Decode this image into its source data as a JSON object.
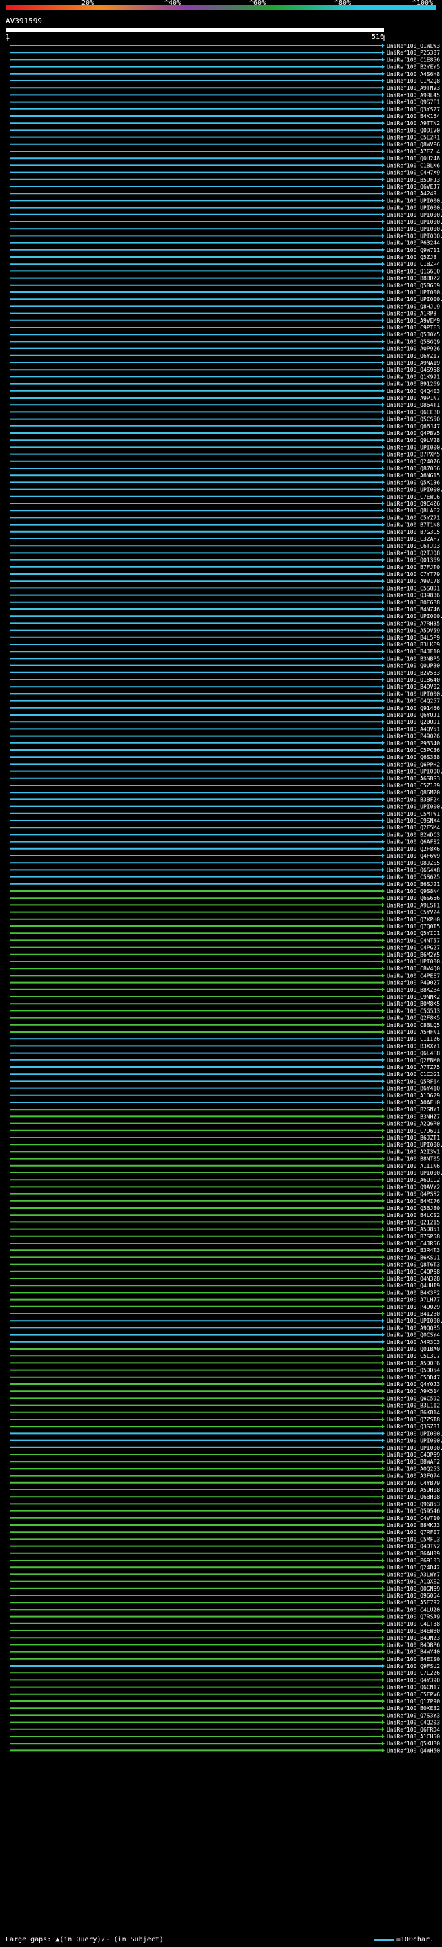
{
  "header": {
    "ticks": [
      "20%",
      "^40%",
      "^60%",
      "^80%",
      "^100%"
    ],
    "query_name": "AV391599",
    "start_label": "1",
    "end_label": "516"
  },
  "colors": {
    "background": "#000000",
    "gradient": [
      "#e8171f",
      "#f28a1c",
      "#8a3ea8",
      "#1fa52f",
      "#27c5e8"
    ],
    "cyan": "#3fc1e8",
    "green": "#4cc23a",
    "magenta": "#c12b9a",
    "white": "#ffffff"
  },
  "footer": {
    "large_gaps_label": "Large gaps: ▲(in Query)/~ (in Subject)",
    "scale_label": "=100char."
  },
  "chart_data": {
    "type": "alignment",
    "query_length": 516,
    "hits": [
      {
        "id": "UniRef100_Q1WLW3",
        "c": "cyan"
      },
      {
        "id": "UniRef100_P25387",
        "c": "cyan"
      },
      {
        "id": "UniRef100_C1E856",
        "c": "cyan"
      },
      {
        "id": "UniRef100_B2YEY5",
        "c": "cyan"
      },
      {
        "id": "UniRef100_A4S6H8",
        "c": "cyan"
      },
      {
        "id": "UniRef100_C1MZQ8",
        "c": "cyan"
      },
      {
        "id": "UniRef100_A9TNV3",
        "c": "cyan"
      },
      {
        "id": "UniRef100_A9RL45",
        "c": "cyan"
      },
      {
        "id": "UniRef100_Q9S7F1",
        "c": "cyan"
      },
      {
        "id": "UniRef100_Q3YS27",
        "c": "cyan"
      },
      {
        "id": "UniRef100_B4K164",
        "c": "cyan"
      },
      {
        "id": "UniRef100_A9TTN2",
        "c": "cyan"
      },
      {
        "id": "UniRef100_Q0DIV0",
        "c": "cyan"
      },
      {
        "id": "UniRef100_C5E2R1",
        "c": "cyan"
      },
      {
        "id": "UniRef100_Q8WVP6",
        "c": "cyan"
      },
      {
        "id": "UniRef100_A7EZL4",
        "c": "cyan"
      },
      {
        "id": "UniRef100_Q0U248",
        "c": "cyan"
      },
      {
        "id": "UniRef100_C1BLK6",
        "c": "cyan"
      },
      {
        "id": "UniRef100_C4H7X9",
        "c": "cyan"
      },
      {
        "id": "UniRef100_B5DFJ3",
        "c": "cyan"
      },
      {
        "id": "UniRef100_Q6VEJ7",
        "c": "cyan"
      },
      {
        "id": "UniRef100_A4249",
        "c": "cyan"
      },
      {
        "id": "UniRef100_UPI000...",
        "c": "cyan"
      },
      {
        "id": "UniRef100_UPI000...",
        "c": "cyan"
      },
      {
        "id": "UniRef100_UPI000...",
        "c": "cyan"
      },
      {
        "id": "UniRef100_UPI000...",
        "c": "cyan"
      },
      {
        "id": "UniRef100_UPI000...",
        "c": "cyan"
      },
      {
        "id": "UniRef100_UPI000...",
        "c": "cyan"
      },
      {
        "id": "UniRef100_P63244",
        "c": "cyan"
      },
      {
        "id": "UniRef100_Q9W711",
        "c": "cyan"
      },
      {
        "id": "UniRef100_Q5ZJ8",
        "c": "cyan"
      },
      {
        "id": "UniRef100_C1BZP4",
        "c": "cyan"
      },
      {
        "id": "UniRef100_Q1G6E0",
        "c": "cyan"
      },
      {
        "id": "UniRef100_B8BDZ2",
        "c": "cyan"
      },
      {
        "id": "UniRef100_Q5BG69",
        "c": "cyan"
      },
      {
        "id": "UniRef100_UPI000...",
        "c": "cyan"
      },
      {
        "id": "UniRef100_UPI000...",
        "c": "cyan"
      },
      {
        "id": "UniRef100_Q8HJL9",
        "c": "cyan"
      },
      {
        "id": "UniRef100_A1RP8",
        "c": "cyan"
      },
      {
        "id": "UniRef100_A9VEM9",
        "c": "cyan"
      },
      {
        "id": "UniRef100_C9PTF3",
        "c": "cyan"
      },
      {
        "id": "UniRef100_Q5J0Y5",
        "c": "cyan"
      },
      {
        "id": "UniRef100_Q5SGQ9",
        "c": "cyan"
      },
      {
        "id": "UniRef100_A0P926",
        "c": "cyan"
      },
      {
        "id": "UniRef100_Q6YZ17",
        "c": "cyan"
      },
      {
        "id": "UniRef100_A9NA19",
        "c": "cyan"
      },
      {
        "id": "UniRef100_Q4S958",
        "c": "cyan"
      },
      {
        "id": "UniRef100_Q1K991",
        "c": "cyan"
      },
      {
        "id": "UniRef100_B91269",
        "c": "cyan"
      },
      {
        "id": "UniRef100_Q4Q403",
        "c": "cyan"
      },
      {
        "id": "UniRef100_A9P1N7",
        "c": "cyan"
      },
      {
        "id": "UniRef100_Q864T1",
        "c": "cyan"
      },
      {
        "id": "UniRef100_Q6EEB0",
        "c": "cyan"
      },
      {
        "id": "UniRef100_Q5CS50",
        "c": "cyan"
      },
      {
        "id": "UniRef100_Q66J47",
        "c": "cyan"
      },
      {
        "id": "UniRef100_Q4PBV5",
        "c": "cyan"
      },
      {
        "id": "UniRef100_Q9LV28",
        "c": "cyan"
      },
      {
        "id": "UniRef100_UPI000...",
        "c": "cyan"
      },
      {
        "id": "UniRef100_B7PXM5",
        "c": "cyan"
      },
      {
        "id": "UniRef100_Q24076",
        "c": "cyan"
      },
      {
        "id": "UniRef100_Q87066",
        "c": "cyan"
      },
      {
        "id": "UniRef100_A6NG15",
        "c": "cyan"
      },
      {
        "id": "UniRef100_Q5X136",
        "c": "cyan"
      },
      {
        "id": "UniRef100_UPI000...",
        "c": "cyan"
      },
      {
        "id": "UniRef100_C7EWL6",
        "c": "cyan"
      },
      {
        "id": "UniRef100_Q9C4Z6",
        "c": "cyan"
      },
      {
        "id": "UniRef100_Q8LAF2",
        "c": "cyan"
      },
      {
        "id": "UniRef100_C5YZ71",
        "c": "cyan"
      },
      {
        "id": "UniRef100_B7T1N8",
        "c": "cyan"
      },
      {
        "id": "UniRef100_B7G3C5",
        "c": "cyan"
      },
      {
        "id": "UniRef100_C3ZAF7",
        "c": "cyan"
      },
      {
        "id": "UniRef100_C6TJD3",
        "c": "cyan"
      },
      {
        "id": "UniRef100_Q2TJQ8",
        "c": "cyan"
      },
      {
        "id": "UniRef100_Q01369",
        "c": "cyan"
      },
      {
        "id": "UniRef100_B7FJT0",
        "c": "cyan"
      },
      {
        "id": "UniRef100_C7YT79",
        "c": "cyan"
      },
      {
        "id": "UniRef100_A9V178",
        "c": "cyan"
      },
      {
        "id": "UniRef100_C5SQD1",
        "c": "cyan"
      },
      {
        "id": "UniRef100_Q39836",
        "c": "cyan"
      },
      {
        "id": "UniRef100_B0EGB8",
        "c": "cyan"
      },
      {
        "id": "UniRef100_B4NZ46",
        "c": "cyan"
      },
      {
        "id": "UniRef100_UPI000...",
        "c": "cyan"
      },
      {
        "id": "UniRef100_A7RH35",
        "c": "cyan"
      },
      {
        "id": "UniRef100_A5DV59",
        "c": "cyan"
      },
      {
        "id": "UniRef100_B4L5P9",
        "c": "cyan"
      },
      {
        "id": "UniRef100_B3LKF9",
        "c": "cyan"
      },
      {
        "id": "UniRef100_B4JE10",
        "c": "cyan"
      },
      {
        "id": "UniRef100_B3NBP5",
        "c": "cyan"
      },
      {
        "id": "UniRef100_Q0UP30",
        "c": "cyan"
      },
      {
        "id": "UniRef100_B2V583",
        "c": "cyan"
      },
      {
        "id": "UniRef100_Q18640",
        "c": "cyan"
      },
      {
        "id": "UniRef100_B4DV02",
        "c": "cyan"
      },
      {
        "id": "UniRef100_UPI000...",
        "c": "cyan"
      },
      {
        "id": "UniRef100_C4Q257",
        "c": "cyan"
      },
      {
        "id": "UniRef100_Q91456",
        "c": "cyan"
      },
      {
        "id": "UniRef100_Q6YUJ1",
        "c": "cyan"
      },
      {
        "id": "UniRef100_Q20UD1",
        "c": "cyan"
      },
      {
        "id": "UniRef100_A4QV51",
        "c": "cyan"
      },
      {
        "id": "UniRef100_P49026",
        "c": "cyan"
      },
      {
        "id": "UniRef100_P93340",
        "c": "cyan"
      },
      {
        "id": "UniRef100_C5PC36",
        "c": "cyan"
      },
      {
        "id": "UniRef100_Q6S338",
        "c": "cyan"
      },
      {
        "id": "UniRef100_Q6PPH2",
        "c": "cyan"
      },
      {
        "id": "UniRef100_UPI000...",
        "c": "cyan"
      },
      {
        "id": "UniRef100_A6SBS3",
        "c": "cyan"
      },
      {
        "id": "UniRef100_C5Z189",
        "c": "cyan"
      },
      {
        "id": "UniRef100_Q86M20",
        "c": "cyan"
      },
      {
        "id": "UniRef100_B3BF24",
        "c": "cyan"
      },
      {
        "id": "UniRef100_UPI000...",
        "c": "cyan"
      },
      {
        "id": "UniRef100_C5MTW1",
        "c": "cyan"
      },
      {
        "id": "UniRef100_C9SNX4",
        "c": "cyan"
      },
      {
        "id": "UniRef100_Q2F5M4",
        "c": "cyan"
      },
      {
        "id": "UniRef100_B2WDC3",
        "c": "cyan"
      },
      {
        "id": "UniRef100_Q6AFS2",
        "c": "cyan"
      },
      {
        "id": "UniRef100_Q2F8K6",
        "c": "cyan"
      },
      {
        "id": "UniRef100_Q4F6W9",
        "c": "cyan"
      },
      {
        "id": "UniRef100_Q8JZS5",
        "c": "cyan"
      },
      {
        "id": "UniRef100_Q6S4X8",
        "c": "cyan"
      },
      {
        "id": "UniRef100_C5S625",
        "c": "cyan"
      },
      {
        "id": "UniRef100_B6SJ21",
        "c": "cyan"
      },
      {
        "id": "UniRef100_Q9S8N4",
        "c": "green"
      },
      {
        "id": "UniRef100_Q6S656",
        "c": "green"
      },
      {
        "id": "UniRef100_A9LST1",
        "c": "green"
      },
      {
        "id": "UniRef100_C5YV24",
        "c": "green"
      },
      {
        "id": "UniRef100_Q7XPH0",
        "c": "green"
      },
      {
        "id": "UniRef100_Q7Q0T5",
        "c": "green"
      },
      {
        "id": "UniRef100_Q5YIC1",
        "c": "green"
      },
      {
        "id": "UniRef100_C4NT57",
        "c": "green"
      },
      {
        "id": "UniRef100_C4PG27",
        "c": "green"
      },
      {
        "id": "UniRef100_B6M2Y5",
        "c": "green"
      },
      {
        "id": "UniRef100_UPI000...",
        "c": "green"
      },
      {
        "id": "UniRef100_C8V4Q0",
        "c": "green"
      },
      {
        "id": "UniRef100_C4PEE7",
        "c": "green"
      },
      {
        "id": "UniRef100_P49027",
        "c": "green"
      },
      {
        "id": "UniRef100_B8KZB4",
        "c": "green"
      },
      {
        "id": "UniRef100_C9NNK2",
        "c": "green"
      },
      {
        "id": "UniRef100_B0M8K5",
        "c": "green"
      },
      {
        "id": "UniRef100_C5G5J3",
        "c": "green"
      },
      {
        "id": "UniRef100_Q2F8K5",
        "c": "green"
      },
      {
        "id": "UniRef100_C8BLQ5",
        "c": "green"
      },
      {
        "id": "UniRef100_A5HFN1",
        "c": "green"
      },
      {
        "id": "UniRef100_C1IIZ6",
        "c": "cyan"
      },
      {
        "id": "UniRef100_B3XXY1",
        "c": "cyan"
      },
      {
        "id": "UniRef100_Q6L4F8",
        "c": "cyan"
      },
      {
        "id": "UniRef100_Q2FBM0",
        "c": "cyan"
      },
      {
        "id": "UniRef100_A7TZ75",
        "c": "cyan"
      },
      {
        "id": "UniRef100_C1C2G1",
        "c": "cyan"
      },
      {
        "id": "UniRef100_Q5RF64",
        "c": "cyan"
      },
      {
        "id": "UniRef100_B6Y410",
        "c": "cyan"
      },
      {
        "id": "UniRef100_A1D629",
        "c": "cyan"
      },
      {
        "id": "UniRef100_A0AEU0",
        "c": "cyan"
      },
      {
        "id": "UniRef100_B2GNY1",
        "c": "green"
      },
      {
        "id": "UniRef100_B3NHZ7",
        "c": "green"
      },
      {
        "id": "UniRef100_A2Q6R0",
        "c": "green"
      },
      {
        "id": "UniRef100_C7D6U1",
        "c": "green"
      },
      {
        "id": "UniRef100_B6JZT1",
        "c": "green"
      },
      {
        "id": "UniRef100_UPI000...",
        "c": "green"
      },
      {
        "id": "UniRef100_A2I3W1",
        "c": "green"
      },
      {
        "id": "UniRef100_B8NT05",
        "c": "green"
      },
      {
        "id": "UniRef100_A1IIN6",
        "c": "green"
      },
      {
        "id": "UniRef100_UPI000...",
        "c": "green"
      },
      {
        "id": "UniRef100_A6Q1C2",
        "c": "green"
      },
      {
        "id": "UniRef100_Q9AVY2",
        "c": "green"
      },
      {
        "id": "UniRef100_Q4PSS2",
        "c": "green"
      },
      {
        "id": "UniRef100_B4MI76",
        "c": "green"
      },
      {
        "id": "UniRef100_Q56J80",
        "c": "green"
      },
      {
        "id": "UniRef100_B4LCS2",
        "c": "green"
      },
      {
        "id": "UniRef100_Q21215",
        "c": "green"
      },
      {
        "id": "UniRef100_A5D851",
        "c": "green"
      },
      {
        "id": "UniRef100_B7SP58",
        "c": "green"
      },
      {
        "id": "UniRef100_C4JR56",
        "c": "green"
      },
      {
        "id": "UniRef100_B3R4T3",
        "c": "green"
      },
      {
        "id": "UniRef100_B6KSU1",
        "c": "green"
      },
      {
        "id": "UniRef100_Q8T6T3",
        "c": "green"
      },
      {
        "id": "UniRef100_C4QP68",
        "c": "green"
      },
      {
        "id": "UniRef100_Q4N328",
        "c": "green"
      },
      {
        "id": "UniRef100_Q4UHI9",
        "c": "green"
      },
      {
        "id": "UniRef100_B4K3F2",
        "c": "green"
      },
      {
        "id": "UniRef100_A7LH77",
        "c": "green"
      },
      {
        "id": "UniRef100_P49029",
        "c": "green"
      },
      {
        "id": "UniRef100_B4I2B0",
        "c": "green"
      },
      {
        "id": "UniRef100_UPI000...",
        "c": "cyan"
      },
      {
        "id": "UniRef100_A9QQB5",
        "c": "cyan"
      },
      {
        "id": "UniRef100_Q0CSY4",
        "c": "cyan"
      },
      {
        "id": "UniRef100_A4R3C3",
        "c": "cyan"
      },
      {
        "id": "UniRef100_Q01BA0",
        "c": "green"
      },
      {
        "id": "UniRef100_C5L3C7",
        "c": "green"
      },
      {
        "id": "UniRef100_A5D0P6",
        "c": "green"
      },
      {
        "id": "UniRef100_Q5DD54",
        "c": "green"
      },
      {
        "id": "UniRef100_C5DD47",
        "c": "green"
      },
      {
        "id": "UniRef100_Q4Y0J3",
        "c": "green"
      },
      {
        "id": "UniRef100_A9X514",
        "c": "green"
      },
      {
        "id": "UniRef100_Q6C592",
        "c": "green"
      },
      {
        "id": "UniRef100_B3L112",
        "c": "green"
      },
      {
        "id": "UniRef100_B6KB14",
        "c": "green"
      },
      {
        "id": "UniRef100_Q7ZST8",
        "c": "green"
      },
      {
        "id": "UniRef100_Q3SZ81",
        "c": "green"
      },
      {
        "id": "UniRef100_UPI000...",
        "c": "cyan"
      },
      {
        "id": "UniRef100_UPI000...",
        "c": "cyan"
      },
      {
        "id": "UniRef100_UPI000...",
        "c": "cyan"
      },
      {
        "id": "UniRef100_C4QP69",
        "c": "green"
      },
      {
        "id": "UniRef100_B8WAF2",
        "c": "green"
      },
      {
        "id": "UniRef100_A0Q253",
        "c": "green"
      },
      {
        "id": "UniRef100_A3FQ74",
        "c": "green"
      },
      {
        "id": "UniRef100_C4YB79",
        "c": "green"
      },
      {
        "id": "UniRef100_A5DH08",
        "c": "green"
      },
      {
        "id": "UniRef100_Q6BH08",
        "c": "green"
      },
      {
        "id": "UniRef100_Q96853",
        "c": "green"
      },
      {
        "id": "UniRef100_Q59546",
        "c": "green"
      },
      {
        "id": "UniRef100_C4VT10",
        "c": "green"
      },
      {
        "id": "UniRef100_B8MKJ3",
        "c": "green"
      },
      {
        "id": "UniRef100_Q7RF07",
        "c": "green"
      },
      {
        "id": "UniRef100_C5MFL3",
        "c": "green"
      },
      {
        "id": "UniRef100_Q4DTN2",
        "c": "green"
      },
      {
        "id": "UniRef100_B6AH09",
        "c": "green"
      },
      {
        "id": "UniRef100_P69103",
        "c": "green"
      },
      {
        "id": "UniRef100_Q24D42",
        "c": "green"
      },
      {
        "id": "UniRef100_A3LWY7",
        "c": "green"
      },
      {
        "id": "UniRef100_A1QXE2",
        "c": "green"
      },
      {
        "id": "UniRef100_Q0GN69",
        "c": "green"
      },
      {
        "id": "UniRef100_Q96054",
        "c": "green"
      },
      {
        "id": "UniRef100_A5E792",
        "c": "green"
      },
      {
        "id": "UniRef100_C4LU20",
        "c": "green"
      },
      {
        "id": "UniRef100_Q7RSA9",
        "c": "green"
      },
      {
        "id": "UniRef100_C4LT38",
        "c": "green"
      },
      {
        "id": "UniRef100_B4EW80",
        "c": "green"
      },
      {
        "id": "UniRef100_B4DNZ3",
        "c": "green"
      },
      {
        "id": "UniRef100_B4DBP6",
        "c": "green"
      },
      {
        "id": "UniRef100_B4WY40",
        "c": "green"
      },
      {
        "id": "UniRef100_B4EIS0",
        "c": "green"
      },
      {
        "id": "UniRef100_Q9FSU2",
        "c": "cyan"
      },
      {
        "id": "UniRef100_C7L2Z6",
        "c": "green"
      },
      {
        "id": "UniRef100_Q4Y390",
        "c": "green"
      },
      {
        "id": "UniRef100_Q6CN17",
        "c": "green"
      },
      {
        "id": "UniRef100_C5FPV6",
        "c": "green"
      },
      {
        "id": "UniRef100_Q17P90",
        "c": "green"
      },
      {
        "id": "UniRef100_B0XE32",
        "c": "green"
      },
      {
        "id": "UniRef100_Q7S3Y3",
        "c": "green"
      },
      {
        "id": "UniRef100_C4Q203",
        "c": "green"
      },
      {
        "id": "UniRef100_Q6FRD4",
        "c": "green"
      },
      {
        "id": "UniRef100_A1CH50",
        "c": "green"
      },
      {
        "id": "UniRef100_Q5KUB0",
        "c": "green"
      },
      {
        "id": "UniRef100_Q4WH50",
        "c": "green"
      }
    ]
  }
}
